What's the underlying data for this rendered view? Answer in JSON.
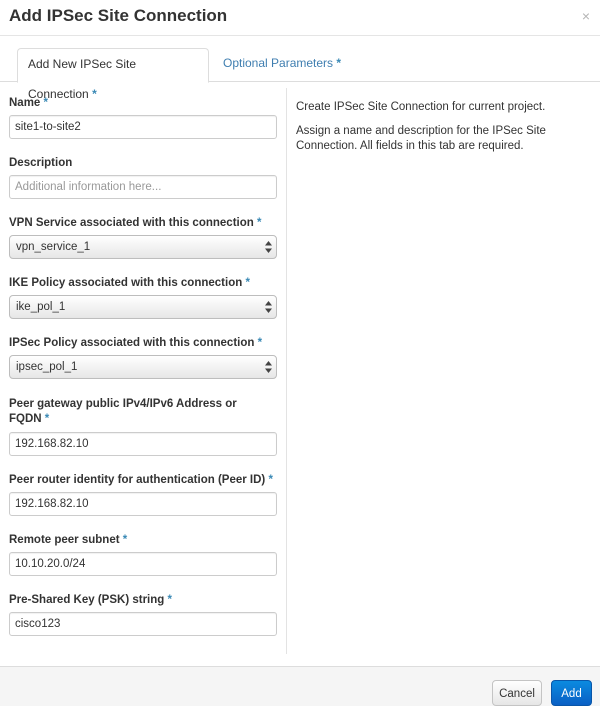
{
  "modal": {
    "title": "Add IPSec Site Connection",
    "close_symbol": "×"
  },
  "tabs": [
    {
      "label": "Add New IPSec Site Connection",
      "required_mark": "*",
      "active": true
    },
    {
      "label": "Optional Parameters",
      "required_mark": "*",
      "active": false
    }
  ],
  "form": {
    "name": {
      "label": "Name",
      "required_mark": "*",
      "value": "site1-to-site2"
    },
    "description": {
      "label": "Description",
      "value": "",
      "placeholder": "Additional information here..."
    },
    "vpn_service": {
      "label": "VPN Service associated with this connection",
      "required_mark": "*",
      "selected": "vpn_service_1"
    },
    "ike_policy": {
      "label": "IKE Policy associated with this connection",
      "required_mark": "*",
      "selected": "ike_pol_1"
    },
    "ipsec_policy": {
      "label": "IPSec Policy associated with this connection",
      "required_mark": "*",
      "selected": "ipsec_pol_1"
    },
    "peer_address": {
      "label_line1": "Peer gateway public IPv4/IPv6 Address or",
      "label_line2": "FQDN",
      "required_mark": "*",
      "value": "192.168.82.10"
    },
    "peer_id": {
      "label": "Peer router identity for authentication (Peer ID)",
      "required_mark": "*",
      "value": "192.168.82.10"
    },
    "remote_subnet": {
      "label": "Remote peer subnet",
      "required_mark": "*",
      "value": "10.10.20.0/24"
    },
    "psk": {
      "label": "Pre-Shared Key (PSK) string",
      "required_mark": "*",
      "value": "cisco123"
    }
  },
  "help": {
    "paragraph1": "Create IPSec Site Connection for current project.",
    "paragraph2": "Assign a name and description for the IPSec Site Connection. All fields in this tab are required."
  },
  "footer": {
    "cancel_label": "Cancel",
    "add_label": "Add"
  },
  "colors": {
    "required_mark": "#3a89b5",
    "link_tab": "#3f7eb0",
    "primary_button": "#0a6fd1"
  }
}
